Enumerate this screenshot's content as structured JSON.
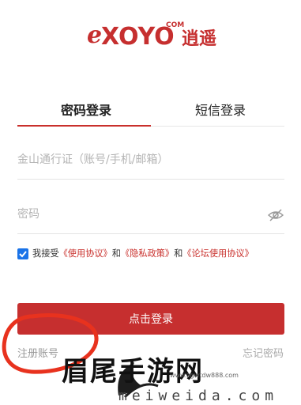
{
  "brand": {
    "logo_text": "eXOYO",
    "logo_com": "COM",
    "logo_cn": "逍遥"
  },
  "tabs": [
    {
      "label": "密码登录",
      "active": true
    },
    {
      "label": "短信登录",
      "active": false
    }
  ],
  "form": {
    "account_placeholder": "金山通行证（账号/手机/邮箱）",
    "password_placeholder": "密码"
  },
  "agreement": {
    "checked": true,
    "prefix": "我接受",
    "link1": "《使用协议》",
    "and1": "和",
    "link2": "《隐私政策》",
    "and2": "和",
    "link3": "《论坛使用协议》"
  },
  "login_button": "点击登录",
  "register_link": "注册账号",
  "forgot_link": "忘记密码",
  "watermark": {
    "title": "眉尾手游网",
    "url": "meiweida.com",
    "site": "www.zgwtdw888.com"
  },
  "colors": {
    "accent": "#c62f2f",
    "checkbox": "#1a73e8",
    "annotation": "#e8321e"
  }
}
